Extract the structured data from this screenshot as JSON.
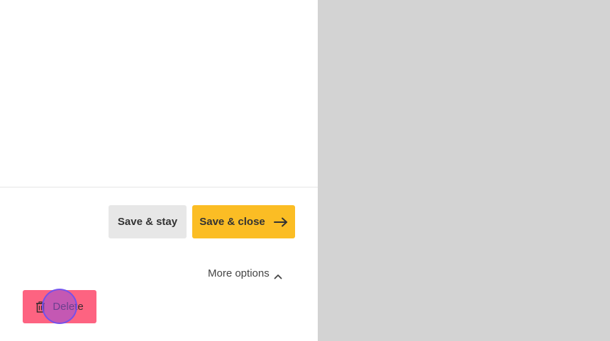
{
  "actions": {
    "save_stay_label": "Save & stay",
    "save_close_label": "Save & close",
    "more_options_label": "More options",
    "delete_label": "Delete"
  },
  "icons": {
    "arrow": "arrow-right-icon",
    "chevron": "chevron-up-icon",
    "trash": "trash-icon"
  },
  "colors": {
    "primary_button": "#fbbd24",
    "secondary_button": "#e7e7e7",
    "danger_button": "#fd6381",
    "side_panel": "#d3d3d3"
  }
}
